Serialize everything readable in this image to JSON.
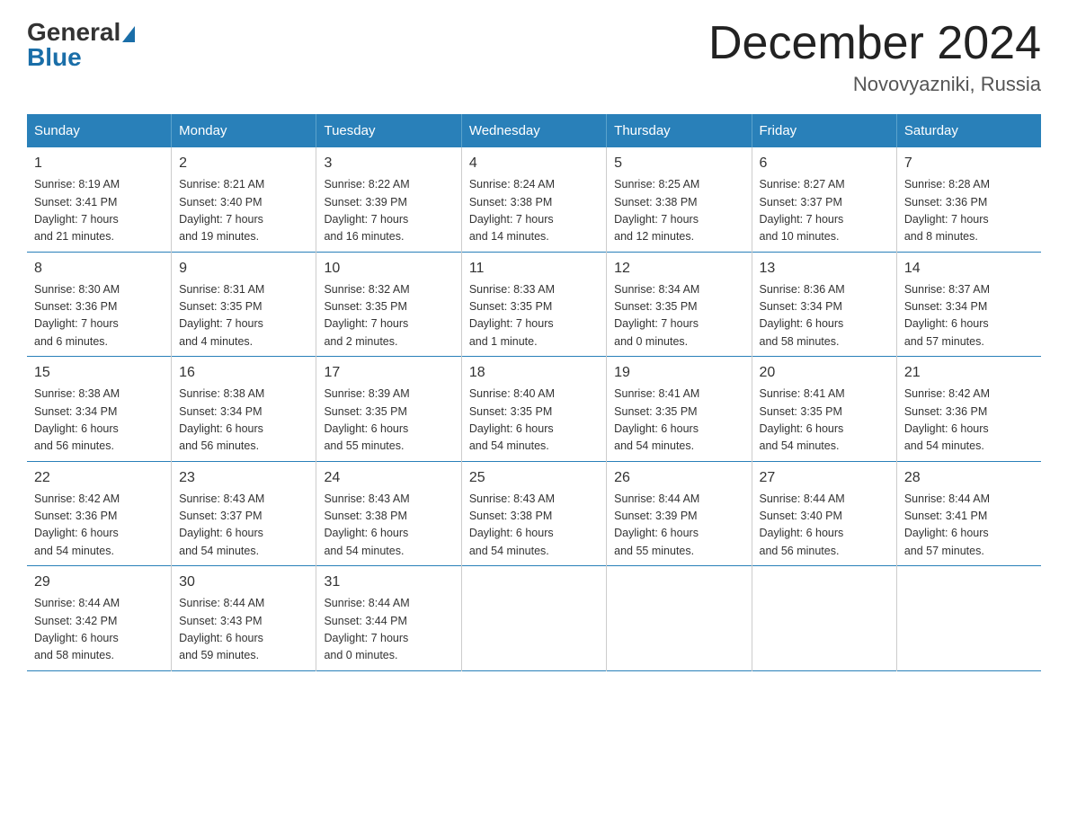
{
  "logo": {
    "general": "General",
    "blue": "Blue"
  },
  "title": "December 2024",
  "subtitle": "Novovyazniki, Russia",
  "days_of_week": [
    "Sunday",
    "Monday",
    "Tuesday",
    "Wednesday",
    "Thursday",
    "Friday",
    "Saturday"
  ],
  "weeks": [
    [
      {
        "day": "1",
        "info": "Sunrise: 8:19 AM\nSunset: 3:41 PM\nDaylight: 7 hours\nand 21 minutes."
      },
      {
        "day": "2",
        "info": "Sunrise: 8:21 AM\nSunset: 3:40 PM\nDaylight: 7 hours\nand 19 minutes."
      },
      {
        "day": "3",
        "info": "Sunrise: 8:22 AM\nSunset: 3:39 PM\nDaylight: 7 hours\nand 16 minutes."
      },
      {
        "day": "4",
        "info": "Sunrise: 8:24 AM\nSunset: 3:38 PM\nDaylight: 7 hours\nand 14 minutes."
      },
      {
        "day": "5",
        "info": "Sunrise: 8:25 AM\nSunset: 3:38 PM\nDaylight: 7 hours\nand 12 minutes."
      },
      {
        "day": "6",
        "info": "Sunrise: 8:27 AM\nSunset: 3:37 PM\nDaylight: 7 hours\nand 10 minutes."
      },
      {
        "day": "7",
        "info": "Sunrise: 8:28 AM\nSunset: 3:36 PM\nDaylight: 7 hours\nand 8 minutes."
      }
    ],
    [
      {
        "day": "8",
        "info": "Sunrise: 8:30 AM\nSunset: 3:36 PM\nDaylight: 7 hours\nand 6 minutes."
      },
      {
        "day": "9",
        "info": "Sunrise: 8:31 AM\nSunset: 3:35 PM\nDaylight: 7 hours\nand 4 minutes."
      },
      {
        "day": "10",
        "info": "Sunrise: 8:32 AM\nSunset: 3:35 PM\nDaylight: 7 hours\nand 2 minutes."
      },
      {
        "day": "11",
        "info": "Sunrise: 8:33 AM\nSunset: 3:35 PM\nDaylight: 7 hours\nand 1 minute."
      },
      {
        "day": "12",
        "info": "Sunrise: 8:34 AM\nSunset: 3:35 PM\nDaylight: 7 hours\nand 0 minutes."
      },
      {
        "day": "13",
        "info": "Sunrise: 8:36 AM\nSunset: 3:34 PM\nDaylight: 6 hours\nand 58 minutes."
      },
      {
        "day": "14",
        "info": "Sunrise: 8:37 AM\nSunset: 3:34 PM\nDaylight: 6 hours\nand 57 minutes."
      }
    ],
    [
      {
        "day": "15",
        "info": "Sunrise: 8:38 AM\nSunset: 3:34 PM\nDaylight: 6 hours\nand 56 minutes."
      },
      {
        "day": "16",
        "info": "Sunrise: 8:38 AM\nSunset: 3:34 PM\nDaylight: 6 hours\nand 56 minutes."
      },
      {
        "day": "17",
        "info": "Sunrise: 8:39 AM\nSunset: 3:35 PM\nDaylight: 6 hours\nand 55 minutes."
      },
      {
        "day": "18",
        "info": "Sunrise: 8:40 AM\nSunset: 3:35 PM\nDaylight: 6 hours\nand 54 minutes."
      },
      {
        "day": "19",
        "info": "Sunrise: 8:41 AM\nSunset: 3:35 PM\nDaylight: 6 hours\nand 54 minutes."
      },
      {
        "day": "20",
        "info": "Sunrise: 8:41 AM\nSunset: 3:35 PM\nDaylight: 6 hours\nand 54 minutes."
      },
      {
        "day": "21",
        "info": "Sunrise: 8:42 AM\nSunset: 3:36 PM\nDaylight: 6 hours\nand 54 minutes."
      }
    ],
    [
      {
        "day": "22",
        "info": "Sunrise: 8:42 AM\nSunset: 3:36 PM\nDaylight: 6 hours\nand 54 minutes."
      },
      {
        "day": "23",
        "info": "Sunrise: 8:43 AM\nSunset: 3:37 PM\nDaylight: 6 hours\nand 54 minutes."
      },
      {
        "day": "24",
        "info": "Sunrise: 8:43 AM\nSunset: 3:38 PM\nDaylight: 6 hours\nand 54 minutes."
      },
      {
        "day": "25",
        "info": "Sunrise: 8:43 AM\nSunset: 3:38 PM\nDaylight: 6 hours\nand 54 minutes."
      },
      {
        "day": "26",
        "info": "Sunrise: 8:44 AM\nSunset: 3:39 PM\nDaylight: 6 hours\nand 55 minutes."
      },
      {
        "day": "27",
        "info": "Sunrise: 8:44 AM\nSunset: 3:40 PM\nDaylight: 6 hours\nand 56 minutes."
      },
      {
        "day": "28",
        "info": "Sunrise: 8:44 AM\nSunset: 3:41 PM\nDaylight: 6 hours\nand 57 minutes."
      }
    ],
    [
      {
        "day": "29",
        "info": "Sunrise: 8:44 AM\nSunset: 3:42 PM\nDaylight: 6 hours\nand 58 minutes."
      },
      {
        "day": "30",
        "info": "Sunrise: 8:44 AM\nSunset: 3:43 PM\nDaylight: 6 hours\nand 59 minutes."
      },
      {
        "day": "31",
        "info": "Sunrise: 8:44 AM\nSunset: 3:44 PM\nDaylight: 7 hours\nand 0 minutes."
      },
      null,
      null,
      null,
      null
    ]
  ]
}
